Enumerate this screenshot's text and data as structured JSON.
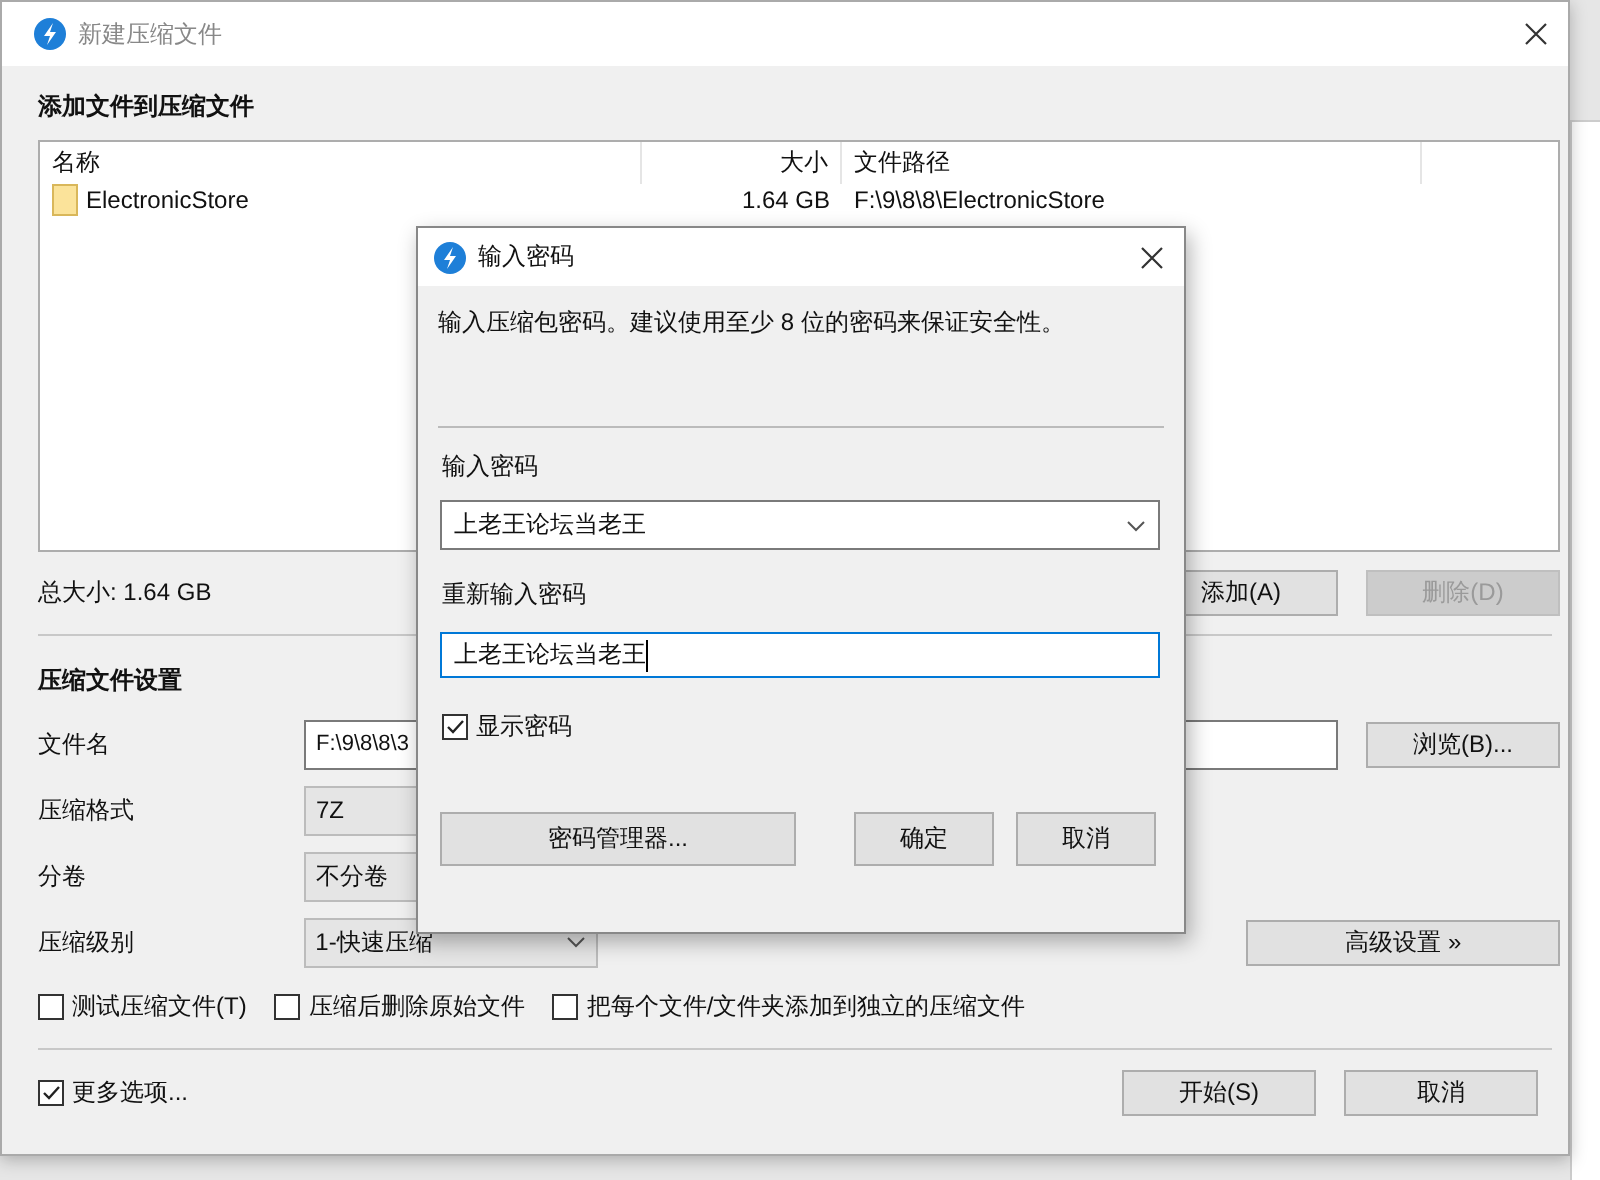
{
  "window": {
    "title": "新建压缩文件"
  },
  "files_section": {
    "title": "添加文件到压缩文件"
  },
  "file_list": {
    "columns": [
      "名称",
      "大小",
      "文件路径"
    ],
    "rows": [
      {
        "name": "ElectronicStore",
        "size": "1.64 GB",
        "path": "F:\\9\\8\\8\\ElectronicStore"
      }
    ]
  },
  "total_size": "总大小: 1.64 GB",
  "list_buttons": [
    {
      "label": "添加(A)",
      "disabled": false
    },
    {
      "label": "删除(D)",
      "disabled": true
    }
  ],
  "settings": {
    "title": "压缩文件设置",
    "fields": [
      {
        "kind": "text",
        "label": "文件名",
        "value": "F:\\9\\8\\8\\3"
      },
      {
        "kind": "select",
        "label": "压缩格式",
        "value": "7Z"
      },
      {
        "kind": "select",
        "label": "分卷",
        "value": "不分卷"
      },
      {
        "kind": "select",
        "label": "压缩级别",
        "value": "1-快速压缩"
      }
    ],
    "browse_button": "浏览(B)...",
    "advanced_button": "高级设置 »",
    "options": [
      {
        "label": "测试压缩文件(T)",
        "checked": false
      },
      {
        "label": "压缩后删除原始文件",
        "checked": false
      },
      {
        "label": "把每个文件/文件夹添加到独立的压缩文件",
        "checked": false
      }
    ]
  },
  "more_options": {
    "label": "更多选项...",
    "checked": true
  },
  "buttons": [
    "开始(S)",
    "取消"
  ],
  "password_dialog": {
    "title": "输入密码",
    "description": "输入压缩包密码。建议使用至少 8 位的密码来保证安全性。",
    "password_label": "输入密码",
    "password": "上老王论坛当老王",
    "confirm_label": "重新输入密码",
    "confirm": "上老王论坛当老王",
    "show_password": {
      "label": "显示密码",
      "checked": true
    },
    "manager_button": "密码管理器...",
    "buttons": [
      "确定",
      "取消"
    ]
  }
}
